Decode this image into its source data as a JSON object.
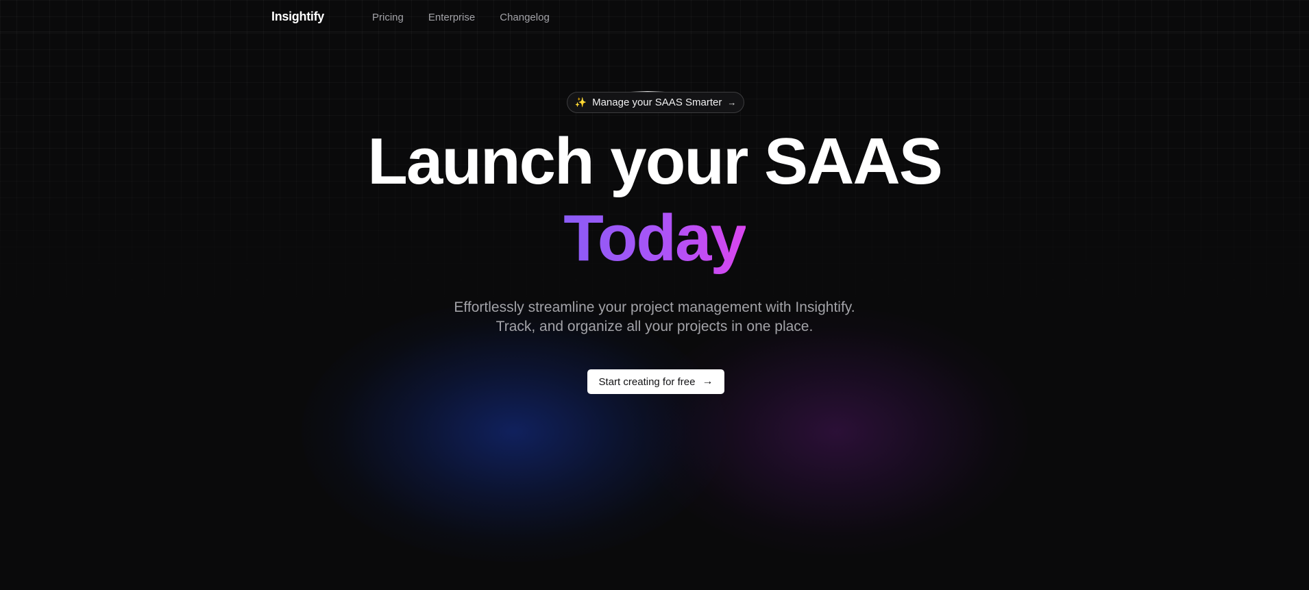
{
  "brand": {
    "name": "Insightify"
  },
  "nav": {
    "links": [
      {
        "label": "Pricing"
      },
      {
        "label": "Enterprise"
      },
      {
        "label": "Changelog"
      }
    ]
  },
  "hero": {
    "badge": {
      "icon": "sparkles-icon",
      "glyph": "✨",
      "label": "Manage your SAAS Smarter",
      "arrow": "→"
    },
    "headline_line1": "Launch your SAAS",
    "headline_line2": "Today",
    "subtitle_line1": "Effortlessly streamline your project management with Insightify.",
    "subtitle_line2": "Track, and organize all your projects in one place.",
    "cta": {
      "label": "Start creating for free",
      "arrow": "→"
    }
  },
  "colors": {
    "background": "#0a0a0b",
    "accent_gradient_start": "#8b5cf6",
    "accent_gradient_end": "#d946ef",
    "muted_text": "#a3a3a8",
    "cta_background": "#ffffff"
  }
}
